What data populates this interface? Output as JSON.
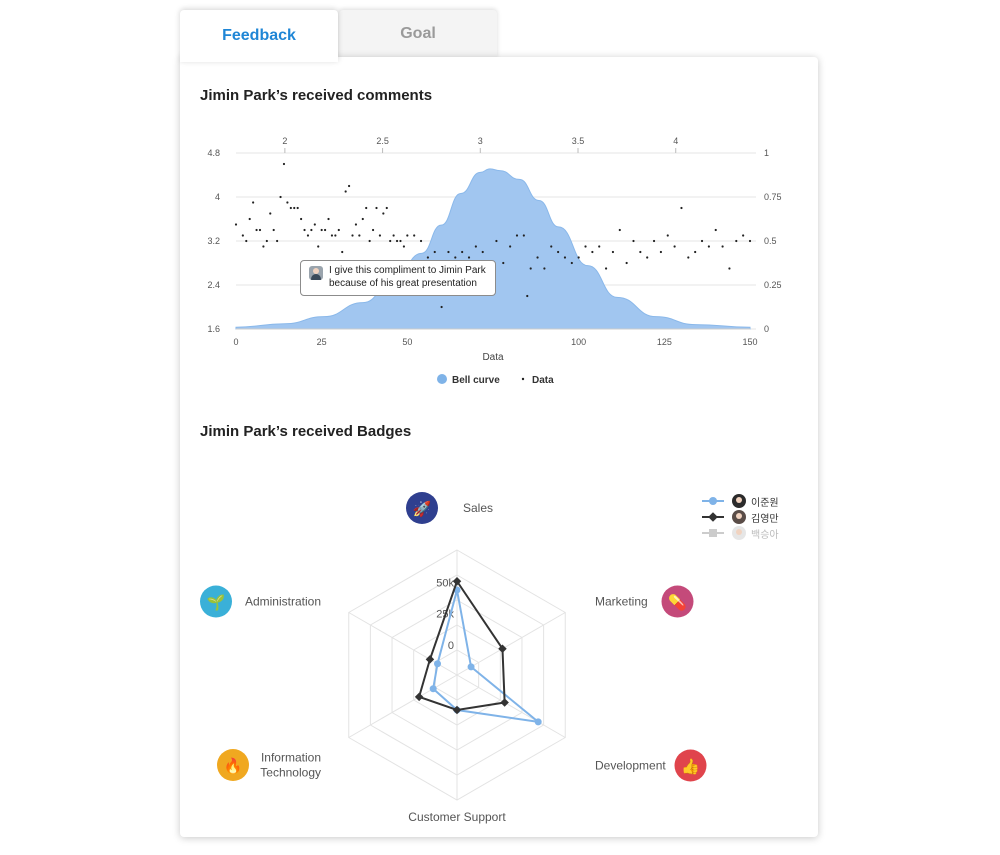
{
  "tabs": [
    {
      "label": "Feedback",
      "active": true
    },
    {
      "label": "Goal",
      "active": false
    }
  ],
  "comments_section": {
    "title": "Jimin Park’s received comments"
  },
  "tooltip": {
    "line1": "I give this compliment to Jimin Park",
    "line2": "because of his great presentation"
  },
  "badges_section": {
    "title": "Jimin Park’s received Badges"
  },
  "colors": {
    "accent": "#1f86d6",
    "bell": "#a1c6f0",
    "series1": "#7fb3e8",
    "series2": "#333333",
    "series3": "#cccccc"
  },
  "chart_data": [
    {
      "type": "area",
      "title": "Jimin Park’s received comments",
      "xlabel": "Data",
      "x_ticks": [
        0,
        25,
        50,
        100,
        125,
        150
      ],
      "x_tick_labels": [
        "0",
        "25",
        "50",
        "100",
        "125",
        "150"
      ],
      "xlim": [
        0,
        150
      ],
      "y_ticks": [
        1.6,
        2.4,
        3.2,
        4,
        4.8
      ],
      "y_tick_labels": [
        "1.6",
        "2.4",
        "3.2",
        "4",
        "4.8"
      ],
      "ylim": [
        1.6,
        4.8
      ],
      "x2_ticks": [
        2,
        2.5,
        3,
        3.5,
        4
      ],
      "x2_tick_labels": [
        "2",
        "2.5",
        "3",
        "3.5",
        "4"
      ],
      "x2lim": [
        1.75,
        4.38
      ],
      "y2_ticks": [
        0,
        0.25,
        0.5,
        0.75,
        1
      ],
      "y2_tick_labels": [
        "0",
        "0.25",
        "0.5",
        "0.75",
        "1"
      ],
      "y2lim": [
        0,
        1
      ],
      "legend": [
        {
          "name": "Bell curve",
          "marker": "circle"
        },
        {
          "name": "Data",
          "marker": "dot"
        }
      ],
      "legend_position": "bottom",
      "bell_curve": {
        "x": [
          1.75,
          2.0,
          2.2,
          2.4,
          2.55,
          2.7,
          2.8,
          2.9,
          3.0,
          3.05,
          3.1,
          3.2,
          3.3,
          3.4,
          3.55,
          3.7,
          3.9,
          4.1,
          4.38
        ],
        "y": [
          0.01,
          0.03,
          0.07,
          0.15,
          0.26,
          0.43,
          0.59,
          0.77,
          0.89,
          0.91,
          0.9,
          0.85,
          0.73,
          0.58,
          0.36,
          0.18,
          0.07,
          0.025,
          0.01
        ]
      },
      "series": [
        {
          "name": "Data",
          "x": [
            0,
            2,
            3,
            4,
            5,
            6,
            7,
            8,
            9,
            10,
            11,
            12,
            13,
            14,
            15,
            16,
            17,
            18,
            19,
            20,
            21,
            22,
            23,
            24,
            25,
            26,
            27,
            28,
            29,
            30,
            31,
            32,
            33,
            34,
            35,
            36,
            37,
            38,
            39,
            40,
            41,
            42,
            43,
            44,
            45,
            46,
            47,
            48,
            49,
            50,
            52,
            54,
            56,
            58,
            60,
            61,
            62,
            64,
            66,
            68,
            70,
            72,
            74,
            76,
            78,
            80,
            82,
            84,
            85,
            86,
            88,
            90,
            92,
            94,
            96,
            98,
            100,
            102,
            104,
            106,
            108,
            110,
            112,
            114,
            116,
            118,
            120,
            122,
            124,
            126,
            128,
            130,
            132,
            134,
            136,
            138,
            140,
            142,
            144,
            146,
            148,
            150
          ],
          "y": [
            3.5,
            3.3,
            3.2,
            3.6,
            3.9,
            3.4,
            3.4,
            3.1,
            3.2,
            3.7,
            3.4,
            3.2,
            4.0,
            4.6,
            3.9,
            3.8,
            3.8,
            3.8,
            3.6,
            3.4,
            3.3,
            3.4,
            3.5,
            3.1,
            3.4,
            3.4,
            3.6,
            3.3,
            3.3,
            3.4,
            3.0,
            4.1,
            4.2,
            3.3,
            3.5,
            3.3,
            3.6,
            3.8,
            3.2,
            3.4,
            3.8,
            3.3,
            3.7,
            3.8,
            3.2,
            3.3,
            3.2,
            3.2,
            3.1,
            3.3,
            3.3,
            3.2,
            2.9,
            3.0,
            2.0,
            2.5,
            3.0,
            2.9,
            3.0,
            2.9,
            3.1,
            3.0,
            2.6,
            3.2,
            2.8,
            3.1,
            3.3,
            3.3,
            2.2,
            2.7,
            2.9,
            2.7,
            3.1,
            3.0,
            2.9,
            2.8,
            2.9,
            3.1,
            3.0,
            3.1,
            2.7,
            3.0,
            3.4,
            2.8,
            3.2,
            3.0,
            2.9,
            3.2,
            3.0,
            3.3,
            3.1,
            3.8,
            2.9,
            3.0,
            3.2,
            3.1,
            3.4,
            3.1,
            2.7,
            3.2,
            3.3,
            3.2
          ]
        }
      ]
    },
    {
      "type": "radar",
      "title": "Jimin Park’s received Badges",
      "axes": [
        "Sales",
        "Marketing",
        "Development",
        "Customer Support",
        "Information Technology",
        "Administration"
      ],
      "axis_labels": [
        "Sales",
        "Marketing",
        "Development",
        "Customer Support",
        "Information\nTechnology",
        "Administration"
      ],
      "axis_icons": [
        "rocket-icon",
        "pills-icon",
        "thumbs-up-icon",
        "none",
        "flame-icon",
        "plant-hand-icon"
      ],
      "axis_icon_colors": [
        "#2f3f8f",
        "#c44a7a",
        "#e0444c",
        "",
        "#f0a820",
        "#3ab0d8"
      ],
      "radial_ticks": [
        0,
        25000,
        50000
      ],
      "radial_tick_labels": [
        "0",
        "25k",
        "50k"
      ],
      "rlim": [
        -25000,
        75000
      ],
      "legend_position": "top-right",
      "series": [
        {
          "name": "이준원",
          "color": "#7fb3e8",
          "marker": "circle",
          "values": [
            43000,
            -12000,
            50000,
            3000,
            -3000,
            -7000
          ]
        },
        {
          "name": "김영만",
          "color": "#333333",
          "marker": "diamond",
          "values": [
            50000,
            17000,
            19000,
            3000,
            10000,
            0
          ]
        },
        {
          "name": "백승아",
          "color": "#cccccc",
          "marker": "square",
          "values": [],
          "hidden": true
        }
      ]
    }
  ]
}
